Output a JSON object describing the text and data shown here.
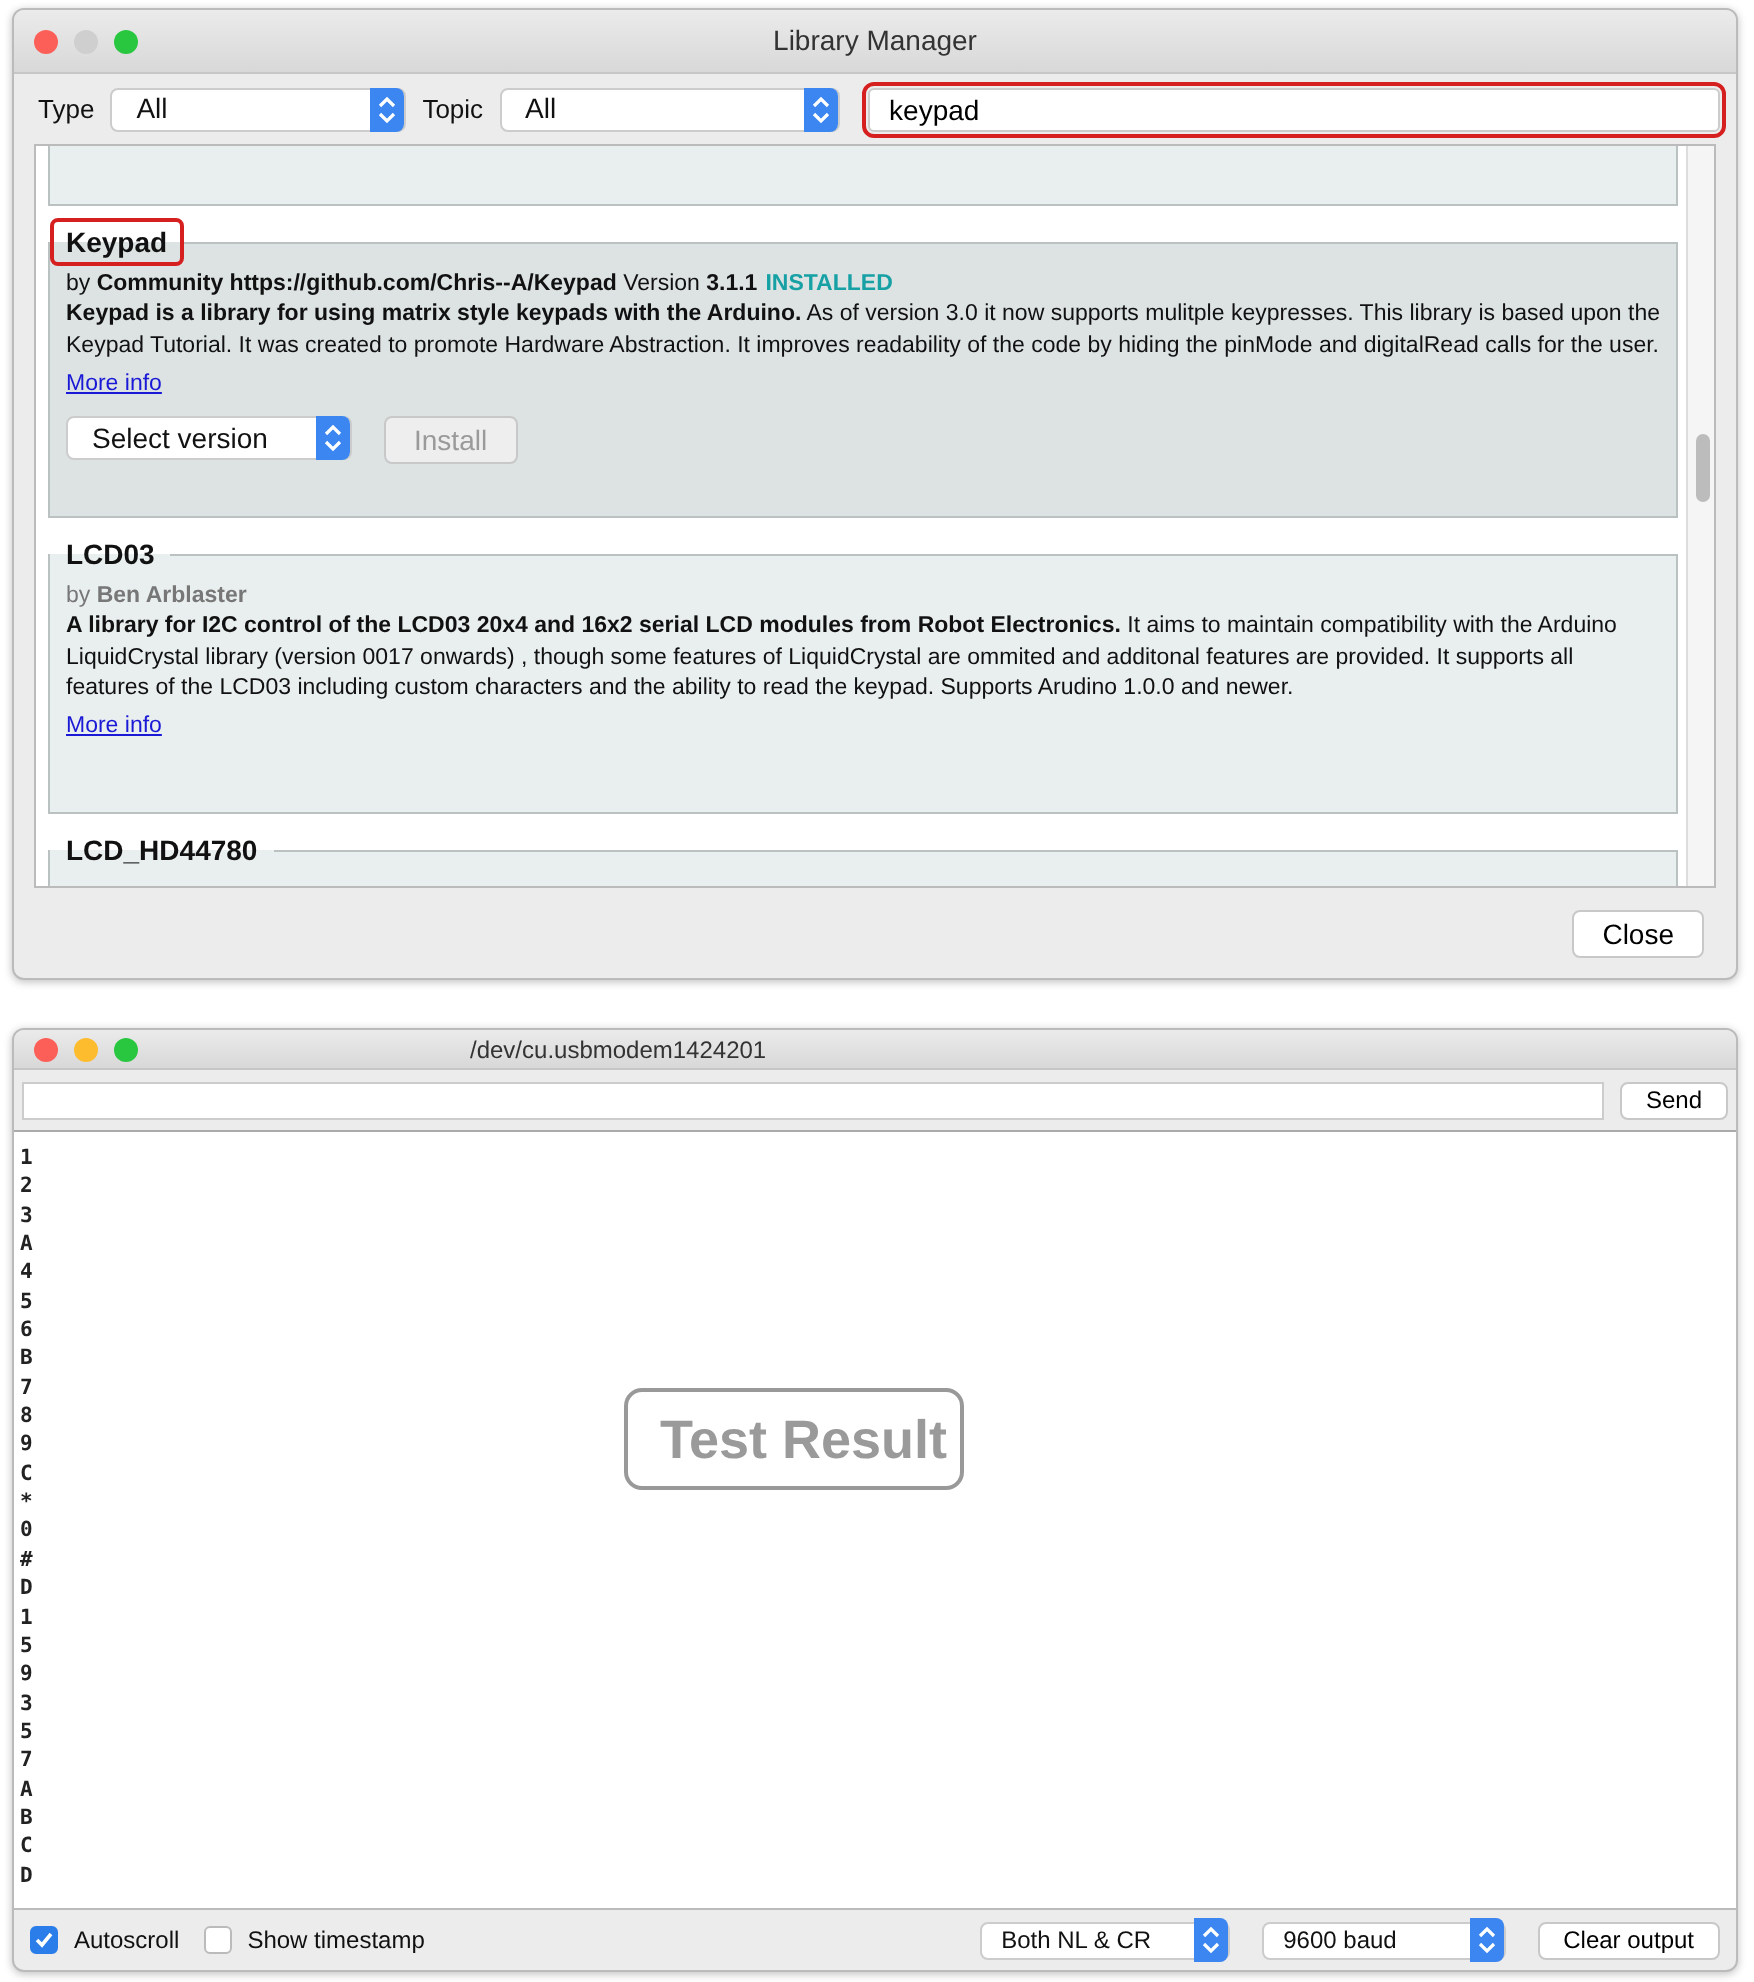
{
  "library_manager": {
    "title": "Library Manager",
    "type_filter": {
      "label": "Type",
      "value": "All"
    },
    "topic_filter": {
      "label": "Topic",
      "value": "All"
    },
    "search": {
      "value": "keypad",
      "highlighted": true
    },
    "libraries": [
      {
        "kind": "blank",
        "selected": false
      },
      {
        "kind": "full",
        "name": "Keypad",
        "highlighted": true,
        "selected": true,
        "byline": "by **Community https://github.com/Chris--A/Keypad** Version **3.1.1**",
        "status": "INSTALLED",
        "description": "**Keypad is a library for using matrix style keypads with the Arduino.** As of version 3.0 it now supports mulitple keypresses. This library is based upon the Keypad Tutorial. It was created to promote Hardware Abstraction. It improves readability of the code by hiding the pinMode and digitalRead calls for the user.",
        "more_info": "More info",
        "version_select": "Select version",
        "install": {
          "label": "Install",
          "disabled": true
        }
      },
      {
        "kind": "full",
        "name": "LCD03",
        "highlighted": false,
        "selected": false,
        "byline": "by **Ben Arblaster**",
        "description": "**A library for I2C control of the LCD03 20x4 and 16x2 serial LCD modules from Robot Electronics.** It aims to maintain compatibility with the Arduino LiquidCrystal library (version 0017 onwards) , though some features of LiquidCrystal are ommited and additonal features are provided. It supports all features of the LCD03 including custom characters and the ability to read the keypad. Supports Arudino 1.0.0 and newer.",
        "more_info": "More info"
      },
      {
        "kind": "title",
        "name": "LCD_HD44780",
        "highlighted": false,
        "selected": false
      }
    ],
    "close": "Close"
  },
  "serial_monitor": {
    "title": "/dev/cu.usbmodem1424201",
    "send": "Send",
    "lines": [
      "1",
      "2",
      "3",
      "A",
      "4",
      "5",
      "6",
      "B",
      "7",
      "8",
      "9",
      "C",
      "*",
      "0",
      "#",
      "D",
      "1",
      "5",
      "9",
      "3",
      "5",
      "7",
      "A",
      "B",
      "C",
      "D"
    ],
    "overlay_label": "Test Result",
    "autoscroll": {
      "label": "Autoscroll",
      "checked": true
    },
    "timestamp": {
      "label": "Show timestamp",
      "checked": false
    },
    "line_ending": "Both NL & CR",
    "baud": "9600 baud",
    "clear": "Clear output"
  }
}
